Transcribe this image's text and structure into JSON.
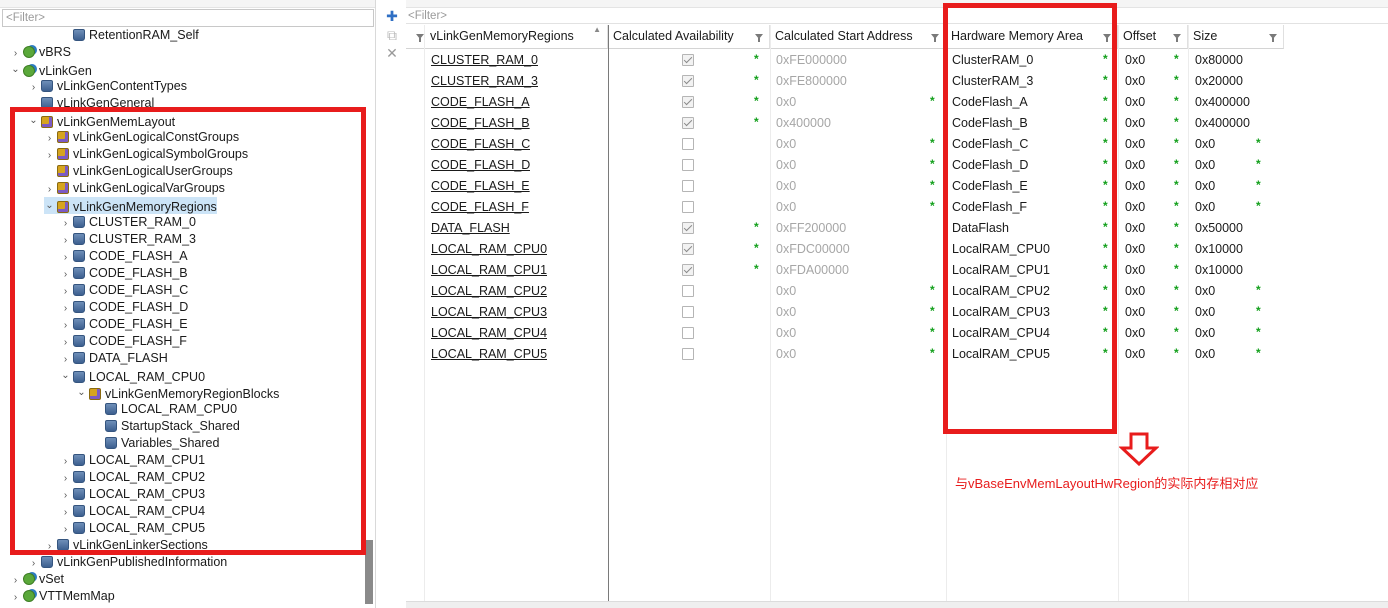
{
  "tree": {
    "filter_placeholder": "<Filter>",
    "items": [
      {
        "label": "RetentionRAM_Self",
        "icon": "db-icon",
        "chev": ""
      },
      {
        "label": "vBRS",
        "icon": "module-icon",
        "chev": ">"
      },
      {
        "label": "vLinkGen",
        "icon": "module-icon",
        "chev": "v"
      },
      {
        "label": "vLinkGenContentTypes",
        "icon": "db-icon",
        "chev": ">"
      },
      {
        "label": "vLinkGenGeneral",
        "icon": "db-icon",
        "chev": ""
      },
      {
        "label": "vLinkGenMemLayout",
        "icon": "container-icon",
        "chev": "v"
      },
      {
        "label": "vLinkGenLogicalConstGroups",
        "icon": "container-icon",
        "chev": ">"
      },
      {
        "label": "vLinkGenLogicalSymbolGroups",
        "icon": "container-icon",
        "chev": ">"
      },
      {
        "label": "vLinkGenLogicalUserGroups",
        "icon": "container-icon",
        "chev": ""
      },
      {
        "label": "vLinkGenLogicalVarGroups",
        "icon": "container-icon",
        "chev": ">"
      },
      {
        "label": "vLinkGenMemoryRegions",
        "icon": "container-icon",
        "chev": "v",
        "selected": true
      },
      {
        "label": "CLUSTER_RAM_0",
        "icon": "db-icon",
        "chev": ">"
      },
      {
        "label": "CLUSTER_RAM_3",
        "icon": "db-icon",
        "chev": ">"
      },
      {
        "label": "CODE_FLASH_A",
        "icon": "db-icon",
        "chev": ">"
      },
      {
        "label": "CODE_FLASH_B",
        "icon": "db-icon",
        "chev": ">"
      },
      {
        "label": "CODE_FLASH_C",
        "icon": "db-icon",
        "chev": ">"
      },
      {
        "label": "CODE_FLASH_D",
        "icon": "db-icon",
        "chev": ">"
      },
      {
        "label": "CODE_FLASH_E",
        "icon": "db-icon",
        "chev": ">"
      },
      {
        "label": "CODE_FLASH_F",
        "icon": "db-icon",
        "chev": ">"
      },
      {
        "label": "DATA_FLASH",
        "icon": "db-icon",
        "chev": ">"
      },
      {
        "label": "LOCAL_RAM_CPU0",
        "icon": "db-icon",
        "chev": "v"
      },
      {
        "label": "vLinkGenMemoryRegionBlocks",
        "icon": "container-icon",
        "chev": "v"
      },
      {
        "label": "LOCAL_RAM_CPU0",
        "icon": "db-icon",
        "chev": ""
      },
      {
        "label": "StartupStack_Shared",
        "icon": "db-icon",
        "chev": ""
      },
      {
        "label": "Variables_Shared",
        "icon": "db-icon",
        "chev": ""
      },
      {
        "label": "LOCAL_RAM_CPU1",
        "icon": "db-icon",
        "chev": ">"
      },
      {
        "label": "LOCAL_RAM_CPU2",
        "icon": "db-icon",
        "chev": ">"
      },
      {
        "label": "LOCAL_RAM_CPU3",
        "icon": "db-icon",
        "chev": ">"
      },
      {
        "label": "LOCAL_RAM_CPU4",
        "icon": "db-icon",
        "chev": ">"
      },
      {
        "label": "LOCAL_RAM_CPU5",
        "icon": "db-icon",
        "chev": ">"
      },
      {
        "label": "vLinkGenLinkerSections",
        "icon": "db-icon",
        "chev": ">"
      },
      {
        "label": "vLinkGenPublishedInformation",
        "icon": "db-icon",
        "chev": ">"
      },
      {
        "label": "vSet",
        "icon": "module-icon",
        "chev": ">"
      },
      {
        "label": "VTTMemMap",
        "icon": "module-icon",
        "chev": ">"
      }
    ]
  },
  "grid": {
    "filter_placeholder": "<Filter>",
    "columns": [
      "vLinkGenMemoryRegions",
      "Calculated Availability",
      "Calculated Start Address",
      "Hardware Memory Area",
      "Offset",
      "Size"
    ],
    "rows": [
      {
        "name": "CLUSTER_RAM_0",
        "avail": true,
        "addr": "0xFE000000",
        "hw": "ClusterRAM_0",
        "offset": "0x0",
        "size": "0x80000"
      },
      {
        "name": "CLUSTER_RAM_3",
        "avail": true,
        "addr": "0xFE800000",
        "hw": "ClusterRAM_3",
        "offset": "0x0",
        "size": "0x20000"
      },
      {
        "name": "CODE_FLASH_A",
        "avail": true,
        "addr": "0x0",
        "hw": "CodeFlash_A",
        "offset": "0x0",
        "size": "0x400000"
      },
      {
        "name": "CODE_FLASH_B",
        "avail": true,
        "addr": "0x400000",
        "hw": "CodeFlash_B",
        "offset": "0x0",
        "size": "0x400000"
      },
      {
        "name": "CODE_FLASH_C",
        "avail": false,
        "addr": "0x0",
        "hw": "CodeFlash_C",
        "offset": "0x0",
        "size": "0x0"
      },
      {
        "name": "CODE_FLASH_D",
        "avail": false,
        "addr": "0x0",
        "hw": "CodeFlash_D",
        "offset": "0x0",
        "size": "0x0"
      },
      {
        "name": "CODE_FLASH_E",
        "avail": false,
        "addr": "0x0",
        "hw": "CodeFlash_E",
        "offset": "0x0",
        "size": "0x0"
      },
      {
        "name": "CODE_FLASH_F",
        "avail": false,
        "addr": "0x0",
        "hw": "CodeFlash_F",
        "offset": "0x0",
        "size": "0x0"
      },
      {
        "name": "DATA_FLASH",
        "avail": true,
        "addr": "0xFF200000",
        "hw": "DataFlash",
        "offset": "0x0",
        "size": "0x50000"
      },
      {
        "name": "LOCAL_RAM_CPU0",
        "avail": true,
        "addr": "0xFDC00000",
        "hw": "LocalRAM_CPU0",
        "offset": "0x0",
        "size": "0x10000"
      },
      {
        "name": "LOCAL_RAM_CPU1",
        "avail": true,
        "addr": "0xFDA00000",
        "hw": "LocalRAM_CPU1",
        "offset": "0x0",
        "size": "0x10000"
      },
      {
        "name": "LOCAL_RAM_CPU2",
        "avail": false,
        "addr": "0x0",
        "hw": "LocalRAM_CPU2",
        "offset": "0x0",
        "size": "0x0"
      },
      {
        "name": "LOCAL_RAM_CPU3",
        "avail": false,
        "addr": "0x0",
        "hw": "LocalRAM_CPU3",
        "offset": "0x0",
        "size": "0x0"
      },
      {
        "name": "LOCAL_RAM_CPU4",
        "avail": false,
        "addr": "0x0",
        "hw": "LocalRAM_CPU4",
        "offset": "0x0",
        "size": "0x0"
      },
      {
        "name": "LOCAL_RAM_CPU5",
        "avail": false,
        "addr": "0x0",
        "hw": "LocalRAM_CPU5",
        "offset": "0x0",
        "size": "0x0"
      }
    ]
  },
  "annotation": {
    "note": "与vBaseEnvMemLayoutHwRegion的实际内存相对应",
    "color": "#e81c1c"
  }
}
